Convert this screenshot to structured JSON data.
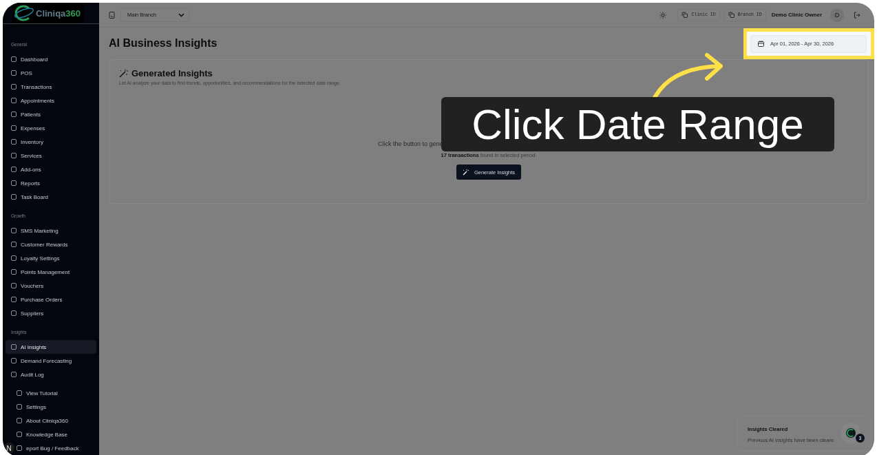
{
  "logo": {
    "text": "Cliniqa",
    "accent": "360"
  },
  "sidebar": {
    "sections": [
      {
        "label": "General",
        "items": [
          {
            "label": "Dashboard",
            "selected": false
          },
          {
            "label": "POS",
            "selected": false
          },
          {
            "label": "Transactions",
            "selected": false
          },
          {
            "label": "Appointments",
            "selected": false
          },
          {
            "label": "Patients",
            "selected": false
          },
          {
            "label": "Expenses",
            "selected": false
          },
          {
            "label": "Inventory",
            "selected": false
          },
          {
            "label": "Services",
            "selected": false
          },
          {
            "label": "Add-ons",
            "selected": false
          },
          {
            "label": "Reports",
            "selected": false
          },
          {
            "label": "Task Board",
            "selected": false
          }
        ]
      },
      {
        "label": "Growth",
        "items": [
          {
            "label": "SMS Marketing",
            "selected": false
          },
          {
            "label": "Customer Rewards",
            "selected": false
          },
          {
            "label": "Loyalty Settings",
            "selected": false
          },
          {
            "label": "Points Management",
            "selected": false
          },
          {
            "label": "Vouchers",
            "selected": false
          },
          {
            "label": "Purchase Orders",
            "selected": false
          },
          {
            "label": "Suppliers",
            "selected": false
          }
        ]
      },
      {
        "label": "Insights",
        "items": [
          {
            "label": "AI Insights",
            "selected": true
          },
          {
            "label": "Demand Forecasting",
            "selected": false
          },
          {
            "label": "Audit Log",
            "selected": false
          }
        ]
      },
      {
        "items": [
          {
            "label": "View Tutorial",
            "selected": false
          },
          {
            "label": "Settings",
            "selected": false
          },
          {
            "label": "About Cliniqa360",
            "selected": false
          },
          {
            "label": "Knowledge Base",
            "selected": false
          },
          {
            "label": "eport Bug / Feedback",
            "selected": false
          }
        ]
      }
    ]
  },
  "dev_badge": "N",
  "topbar": {
    "branch_select": {
      "value": "Main Branch"
    },
    "clinic_id": "Clinic ID",
    "branch_id": "Branch ID",
    "user_name": "Demo Clinic Owner",
    "avatar": "D"
  },
  "page": {
    "title": "AI Business Insights",
    "date_range": "Apr 01, 2026 - Apr 30, 2026"
  },
  "card": {
    "title": "Generated Insights",
    "description": "Let AI analyze your data to find trends, opportunities, and recommendations for the selected date range.",
    "prompt": "Click the button to gene",
    "count_line": "**17 transactions** found in selected period.",
    "button": "Generate Insights"
  },
  "tutorial": {
    "callout": "Click Date Range"
  },
  "toast": {
    "title": "Insights Cleared",
    "message": "Previous AI insights have been cleare"
  },
  "chat": {
    "badge": "3"
  }
}
